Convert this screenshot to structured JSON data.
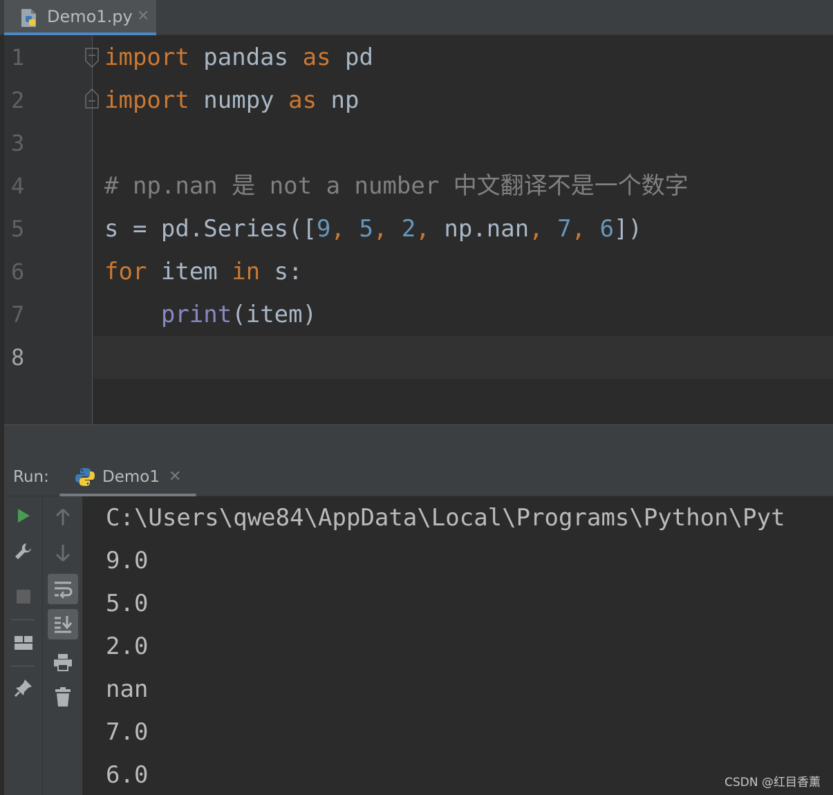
{
  "editor_tab": {
    "file_name": "Demo1.py",
    "close_glyph": "✕",
    "accent": "#4a88c7"
  },
  "editor": {
    "line_numbers": [
      "1",
      "2",
      "3",
      "4",
      "5",
      "6",
      "7",
      "8"
    ],
    "current_line": "8",
    "code": {
      "l1": {
        "kw_import": "import",
        "mod": " pandas ",
        "kw_as": "as",
        "alias": " pd"
      },
      "l2": {
        "kw_import": "import",
        "mod": " numpy ",
        "kw_as": "as",
        "alias": " np"
      },
      "l4": {
        "comment": "# np.nan 是 not a number 中文翻译不是一个数字"
      },
      "l5": {
        "lhs": "s = pd.Series([",
        "n1": "9",
        "c1": ", ",
        "n2": "5",
        "c2": ", ",
        "n3": "2",
        "c3": ", ",
        "nan": "np.nan",
        "c4": ", ",
        "n4": "7",
        "c5": ", ",
        "n5": "6",
        "close": "])"
      },
      "l6": {
        "kw_for": "for",
        "var": " item ",
        "kw_in": "in",
        "rest": " s:"
      },
      "l7": {
        "indent": "    ",
        "fn": "print",
        "args": "(item)"
      }
    },
    "colors": {
      "keyword": "#cc7832",
      "number": "#6897bb",
      "comment": "#808080",
      "builtin": "#8888c6",
      "text": "#a9b7c6"
    }
  },
  "run_panel": {
    "title": "Run:",
    "tab_label": "Demo1",
    "close_glyph": "✕",
    "toolbar_icons": [
      "play-icon",
      "wrench-icon",
      "stop-icon",
      "layout-icon",
      "pin-icon",
      "up-arrow-icon",
      "down-arrow-icon",
      "soft-wrap-icon",
      "scroll-to-end-icon",
      "print-icon",
      "trash-icon"
    ],
    "output": [
      "C:\\Users\\qwe84\\AppData\\Local\\Programs\\Python\\Pyt",
      "9.0",
      "5.0",
      "2.0",
      "nan",
      "7.0",
      "6.0"
    ]
  },
  "watermark": "CSDN @红目香薰"
}
